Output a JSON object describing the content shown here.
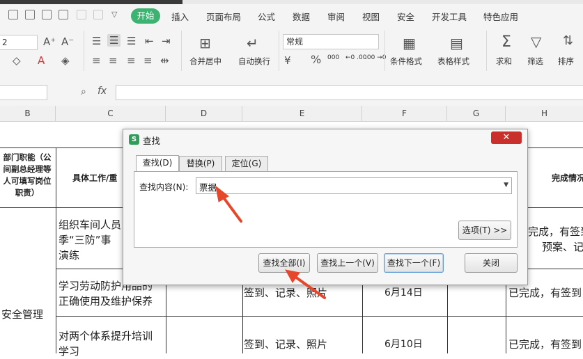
{
  "menubar": {
    "tabs": [
      "开始",
      "插入",
      "页面布局",
      "公式",
      "数据",
      "审阅",
      "视图",
      "安全",
      "开发工具",
      "特色应用"
    ],
    "active_tab": "开始",
    "accent": "#3cb371"
  },
  "ribbon": {
    "font_size": "2",
    "number_format": "常规",
    "merge_label": "合并居中",
    "wrap_label": "自动换行",
    "cond_format_label": "条件格式",
    "table_style_label": "表格样式",
    "sum_label": "求和",
    "filter_label": "筛选",
    "sort_label": "排序",
    "percent": "%",
    "thousands": "000",
    "dec_inc": "←0 .00",
    "dec_dec": ".00 →0"
  },
  "formula_bar": {
    "fx": "fx"
  },
  "columns": [
    "B",
    "C",
    "D",
    "E",
    "F",
    "G",
    "H"
  ],
  "sheet": {
    "header_b": [
      "部门职能（公",
      "间副总经理等",
      "人可填写岗位",
      "职责）"
    ],
    "header_c": "具体工作/重",
    "header_h": "完成情况",
    "row1_c": [
      "组织车间人员",
      "季“三防”事",
      "演练"
    ],
    "row1_h": [
      "完成，有签到",
      "预案、记"
    ],
    "row2_c": [
      "学习劳动防护用品的",
      "正确使用及维护保养"
    ],
    "row2_e": "签到、记录、照片",
    "row2_f": "6月14日",
    "row2_h": "已完成，有签到",
    "category": "安全管理",
    "row3_c": [
      "对两个体系提升培训",
      "学习"
    ],
    "row3_e": "签到、记录、照片",
    "row3_f": "6月10日",
    "row3_h": "已完成，有签到"
  },
  "dialog": {
    "title": "查找",
    "logo": "S",
    "close": "✕",
    "tabs": [
      "查找(D)",
      "替换(P)",
      "定位(G)"
    ],
    "find_label": "查找内容(N):",
    "find_value": "票据",
    "options_button": "选项(T) >>",
    "find_all": "查找全部(I)",
    "find_prev": "查找上一个(V)",
    "find_next": "查找下一个(F)",
    "close_button": "关闭"
  },
  "arrow_color": "#e8462a"
}
